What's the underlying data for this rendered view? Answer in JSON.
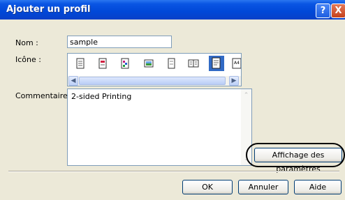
{
  "window": {
    "title": "Ajouter un profil",
    "help_glyph": "?",
    "close_glyph": "X"
  },
  "form": {
    "name_label": "Nom :",
    "name_value": "sample",
    "icon_label": "Icône :",
    "comment_label": "Commentaire :",
    "comment_value": "2-sided Printing"
  },
  "icons": [
    "document-icon",
    "document-red-icon",
    "document-color-icon",
    "picture-icon",
    "document-plain-icon",
    "document-multi-icon",
    "document-selected-icon",
    "a4-icon"
  ],
  "buttons": {
    "settings": "Affichage des paramètres",
    "ok": "OK",
    "cancel": "Annuler",
    "help": "Aide"
  }
}
